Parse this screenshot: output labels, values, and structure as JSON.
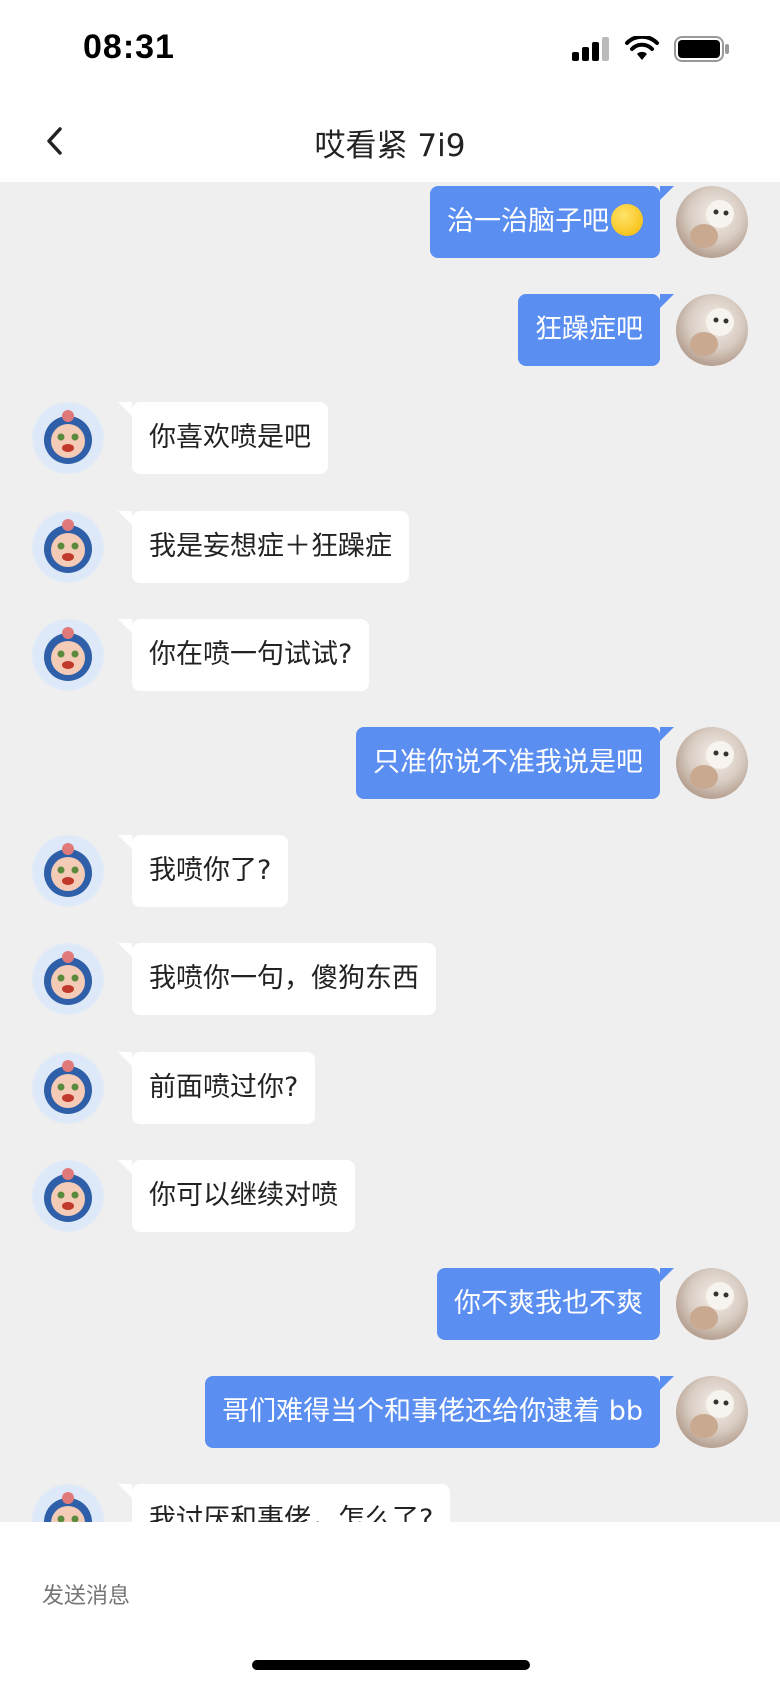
{
  "status_bar": {
    "time": "08:31",
    "battery_level": 0.85
  },
  "header": {
    "title": "哎看紧 7i9"
  },
  "messages": [
    {
      "side": "out",
      "text": "治一治脑子吧",
      "emoji": "sweat-smile-emoji"
    },
    {
      "side": "out",
      "text": "狂躁症吧"
    },
    {
      "side": "in",
      "text": "你喜欢喷是吧"
    },
    {
      "side": "in",
      "text": "我是妄想症＋狂躁症"
    },
    {
      "side": "in",
      "text": "你在喷一句试试?"
    },
    {
      "side": "out",
      "text": "只准你说不准我说是吧"
    },
    {
      "side": "in",
      "text": "我喷你了?"
    },
    {
      "side": "in",
      "text": "我喷你一句，傻狗东西"
    },
    {
      "side": "in",
      "text": "前面喷过你?"
    },
    {
      "side": "in",
      "text": "你可以继续对喷"
    },
    {
      "side": "out",
      "text": "你不爽我也不爽"
    },
    {
      "side": "out",
      "text": "哥们难得当个和事佬还给你逮着 bb"
    },
    {
      "side": "in",
      "text": "我讨厌和事佬，怎么了?"
    }
  ],
  "input": {
    "placeholder": "发送消息"
  },
  "colors": {
    "outgoing_bubble": "#5b8ef1",
    "incoming_bubble": "#ffffff",
    "chat_background": "#efeff0"
  }
}
